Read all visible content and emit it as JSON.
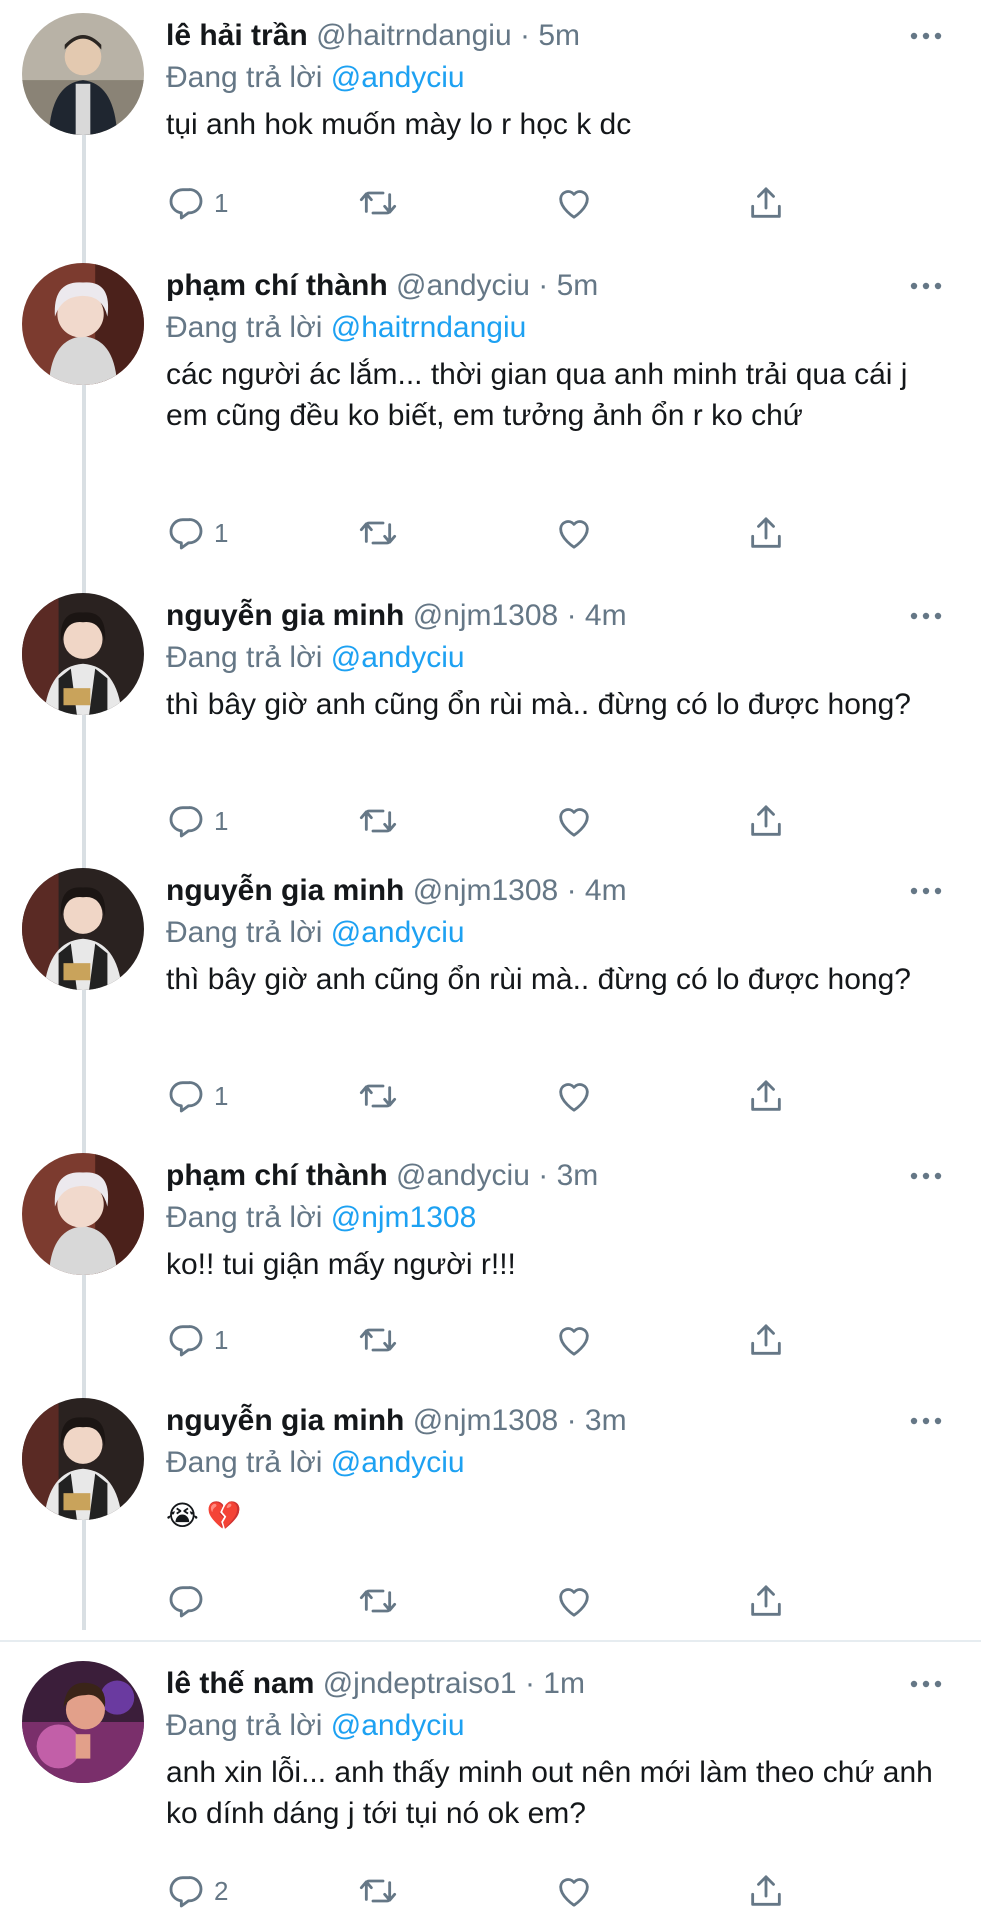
{
  "tweets": [
    {
      "name": "lê hải trần",
      "handle": "@haitrndangiu",
      "time": "5m",
      "replying_prefix": "Đang trả lời ",
      "replying_to": "@andyciu",
      "text": "tụi anh hok muốn mày lo r học k dc",
      "reply_count": "1",
      "avatar_color": "#6b7280"
    },
    {
      "name": "phạm chí thành",
      "handle": "@andyciu",
      "time": "5m",
      "replying_prefix": "Đang trả lời ",
      "replying_to": "@haitrndangiu",
      "text": "các người ác lắm... thời gian qua anh minh trải qua cái j em cũng đều ko biết, em tưởng ảnh ổn r ko chứ",
      "reply_count": "1",
      "avatar_color": "#cfc7c2"
    },
    {
      "name": "nguyễn gia minh",
      "handle": "@njm1308",
      "time": "4m",
      "replying_prefix": "Đang trả lời ",
      "replying_to": "@andyciu",
      "text": "thì bây giờ anh cũng ổn rùi mà.. đừng có lo được hong?",
      "reply_count": "1",
      "avatar_color": "#3a2e2c"
    },
    {
      "name": "nguyễn gia minh",
      "handle": "@njm1308",
      "time": "4m",
      "replying_prefix": "Đang trả lời ",
      "replying_to": "@andyciu",
      "text": "thì bây giờ anh cũng ổn rùi mà.. đừng có lo được hong?",
      "reply_count": "1",
      "avatar_color": "#3a2e2c"
    },
    {
      "name": "phạm chí thành",
      "handle": "@andyciu",
      "time": "3m",
      "replying_prefix": "Đang trả lời ",
      "replying_to": "@njm1308",
      "text": "ko!! tui giận mấy người r!!!",
      "reply_count": "1",
      "avatar_color": "#cfc7c2"
    },
    {
      "name": "nguyễn gia minh",
      "handle": "@njm1308",
      "time": "3m",
      "replying_prefix": "Đang trả lời ",
      "replying_to": "@andyciu",
      "text": "😭 💔",
      "reply_count": "",
      "avatar_color": "#3a2e2c"
    },
    {
      "name": "lê thế nam",
      "handle": "@jndeptraiso1",
      "time": "1m",
      "replying_prefix": "Đang trả lời ",
      "replying_to": "@andyciu",
      "text": "anh xin lỗi... anh thấy minh out nên mới làm theo chứ anh ko dính dáng j tới tụi nó ok em?",
      "reply_count": "2",
      "avatar_color": "#b4579a"
    }
  ],
  "separator": " · ",
  "icons": {
    "reply": "reply-icon",
    "retweet": "retweet-icon",
    "like": "heart-icon",
    "share": "share-icon",
    "more": "more-icon"
  },
  "colors": {
    "accent": "#1da1f2",
    "muted": "#657786",
    "text": "#14171a"
  }
}
